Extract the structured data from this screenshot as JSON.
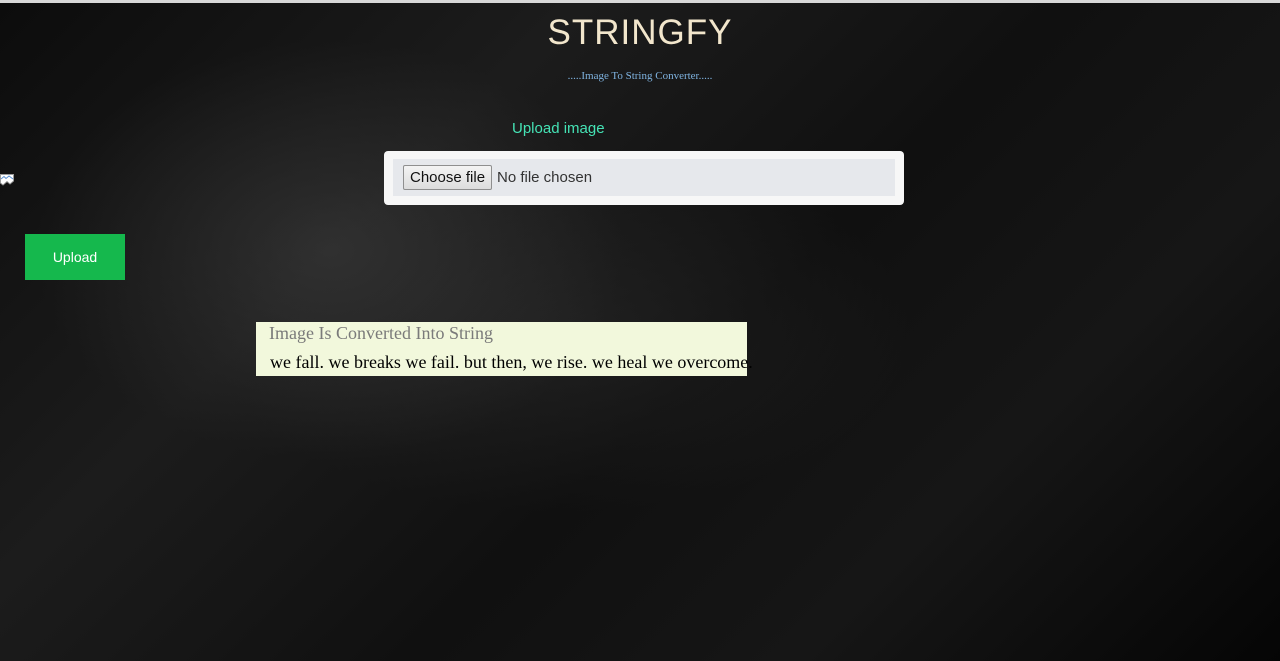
{
  "header": {
    "title": "STRINGFY",
    "subtitle": ".....Image To String Converter....."
  },
  "upload_form": {
    "label": "Upload image",
    "choose_button_label": "Choose file",
    "file_status": "No file chosen",
    "upload_button_label": "Upload"
  },
  "result": {
    "heading": "Image Is Converted Into String",
    "text": "we fall. we breaks we fail. but then, we rise. we heal we overcome."
  },
  "icons": {
    "broken_image": "broken-image-icon"
  },
  "colors": {
    "title": "#f2e6cc",
    "subtitle": "#7fb3e0",
    "upload_label": "#45e3b5",
    "upload_button": "#15b84d",
    "result_background": "#f2f8dc"
  }
}
